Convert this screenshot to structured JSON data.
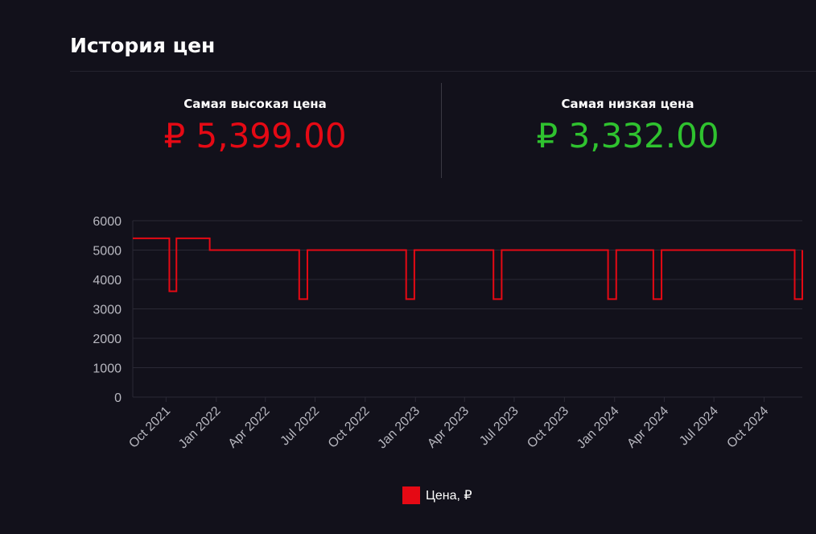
{
  "page": {
    "title": "История цен"
  },
  "stats": {
    "high_label": "Самая высокая цена",
    "high_value": "₽ 5,399.00",
    "low_label": "Самая низкая цена",
    "low_value": "₽ 3,332.00"
  },
  "colors": {
    "line": "#e50914",
    "high": "#e50914",
    "low": "#2fc22f",
    "grid": "#2a2935",
    "tick": "#b8b8c0"
  },
  "chart_data": {
    "type": "line",
    "step": true,
    "xlabel": "",
    "ylabel": "",
    "ylim": [
      0,
      6000
    ],
    "yticks": [
      0,
      1000,
      2000,
      3000,
      4000,
      5000,
      6000
    ],
    "x_ticks": [
      "Oct 2021",
      "Jan 2022",
      "Apr 2022",
      "Jul 2022",
      "Oct 2022",
      "Jan 2023",
      "Apr 2023",
      "Jul 2023",
      "Oct 2023",
      "Jan 2024",
      "Apr 2024",
      "Jul 2024",
      "Oct 2024"
    ],
    "legend": {
      "position": "bottom",
      "entries": [
        "Цена, ₽"
      ]
    },
    "grid": true,
    "series": [
      {
        "name": "Цена, ₽",
        "points": [
          [
            "2021-08-01",
            5399
          ],
          [
            "2021-10-07",
            3600
          ],
          [
            "2021-10-20",
            5399
          ],
          [
            "2021-12-20",
            5000
          ],
          [
            "2022-06-02",
            3332
          ],
          [
            "2022-06-17",
            5000
          ],
          [
            "2022-12-15",
            3332
          ],
          [
            "2022-12-30",
            5000
          ],
          [
            "2023-05-24",
            3332
          ],
          [
            "2023-06-08",
            5000
          ],
          [
            "2023-12-20",
            3332
          ],
          [
            "2024-01-04",
            5000
          ],
          [
            "2024-03-12",
            3332
          ],
          [
            "2024-03-27",
            5000
          ],
          [
            "2024-11-26",
            3332
          ],
          [
            "2024-12-10",
            5000
          ]
        ]
      }
    ]
  }
}
